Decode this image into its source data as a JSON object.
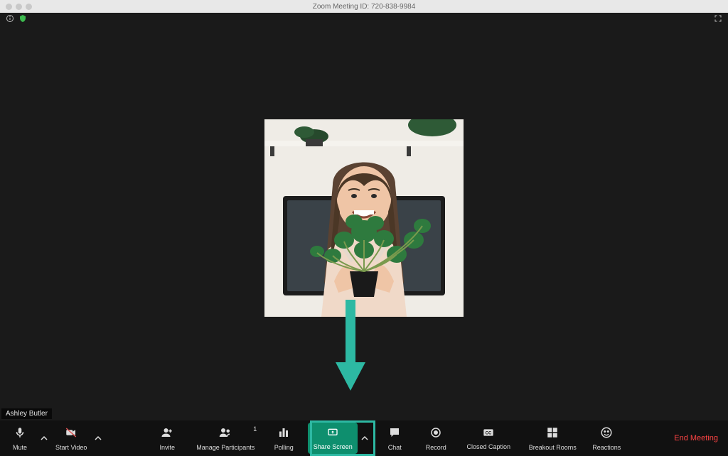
{
  "titlebar": {
    "title": "Zoom Meeting ID: 720-838-9984"
  },
  "topstrip": {
    "info_icon": "info-icon",
    "encryption_icon": "lock-icon",
    "fullscreen_icon": "fullscreen-icon"
  },
  "participant": {
    "name": "Ashley Butler"
  },
  "toolbar": {
    "mute": "Mute",
    "start_video": "Start Video",
    "invite": "Invite",
    "manage_participants": "Manage Participants",
    "participants_count": "1",
    "polling": "Polling",
    "share_screen": "Share Screen",
    "chat": "Chat",
    "record": "Record",
    "closed_caption": "Closed Caption",
    "breakout_rooms": "Breakout Rooms",
    "reactions": "Reactions",
    "end_meeting": "End Meeting"
  }
}
